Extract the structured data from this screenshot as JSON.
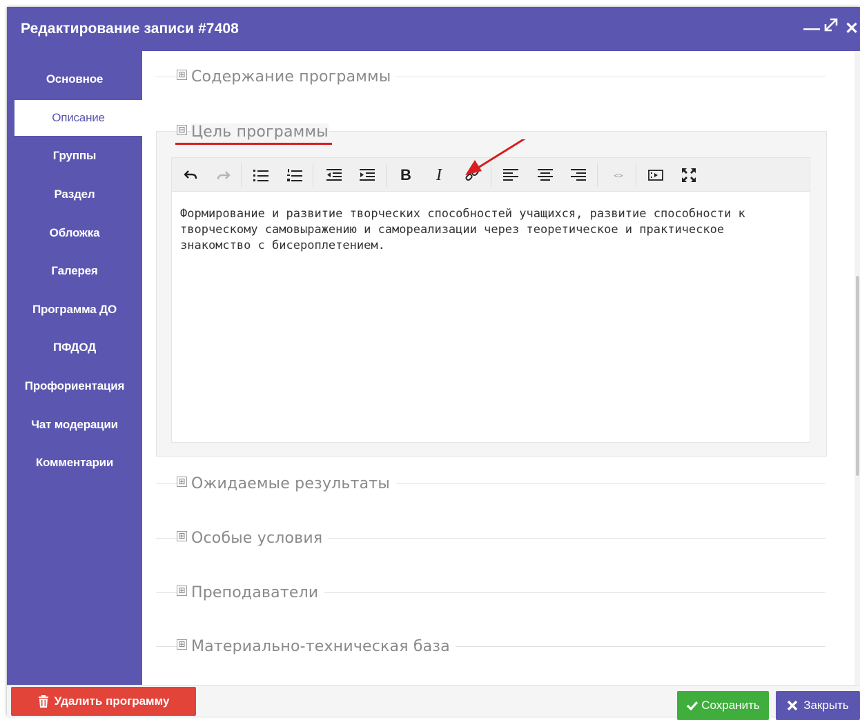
{
  "window": {
    "title": "Редактирование записи #7408"
  },
  "sidebar": {
    "items": [
      {
        "label": "Основное"
      },
      {
        "label": "Описание",
        "active": true
      },
      {
        "label": "Группы"
      },
      {
        "label": "Раздел"
      },
      {
        "label": "Обложка"
      },
      {
        "label": "Галерея"
      },
      {
        "label": "Программа ДО"
      },
      {
        "label": "ПФДОД"
      },
      {
        "label": "Профориентация"
      },
      {
        "label": "Чат модерации"
      },
      {
        "label": "Комментарии"
      }
    ]
  },
  "sections": [
    {
      "label": "Содержание программы",
      "state": "collapsed"
    },
    {
      "label": "Цель программы",
      "state": "expanded"
    },
    {
      "label": "Ожидаемые результаты",
      "state": "collapsed"
    },
    {
      "label": "Особые условия",
      "state": "collapsed"
    },
    {
      "label": "Преподаватели",
      "state": "collapsed"
    },
    {
      "label": "Материально-техническая база",
      "state": "collapsed"
    }
  ],
  "toggle": {
    "expanded": "⊟",
    "collapsed": "⊞"
  },
  "editor": {
    "content": "Формирование и развитие творческих способностей учащихся, развитие способности к творческому самовыражению и самореализации через теоретическое и практическое знакомство с бисероплетением.",
    "toolbar": [
      "undo-icon",
      "redo-icon",
      "bullet-list-icon",
      "numbered-list-icon",
      "outdent-icon",
      "indent-icon",
      "bold-icon",
      "italic-icon",
      "link-icon",
      "align-left-icon",
      "align-center-icon",
      "align-right-icon",
      "code-icon",
      "media-icon",
      "fullscreen-icon"
    ]
  },
  "footer": {
    "delete_label": "Удалить программу",
    "save_label": "Сохранить",
    "close_label": "Закрыть"
  },
  "colors": {
    "primary": "#5b56b0",
    "danger": "#e2443a",
    "success": "#3fae3c",
    "annotation": "#d81e1e"
  }
}
